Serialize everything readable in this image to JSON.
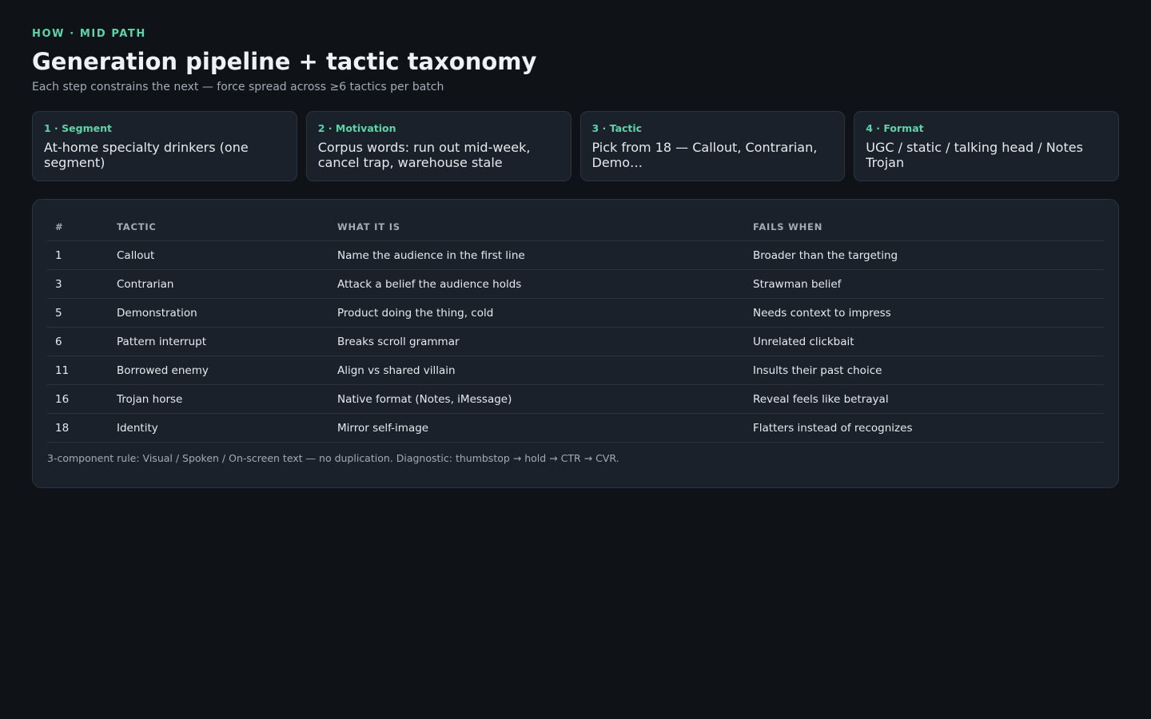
{
  "header": {
    "eyebrow": "HOW · MID PATH",
    "title": "Generation pipeline + tactic taxonomy",
    "subtitle": "Each step constrains the next — force spread across ≥6 tactics per batch"
  },
  "steps": [
    {
      "label": "1 · Segment",
      "text": "At-home specialty drinkers (one segment)"
    },
    {
      "label": "2 · Motivation",
      "text": "Corpus words: run out mid-week, cancel trap, warehouse stale"
    },
    {
      "label": "3 · Tactic",
      "text": "Pick from 18 — Callout, Contrarian, Demo…"
    },
    {
      "label": "4 · Format",
      "text": "UGC / static / talking head / Notes Trojan"
    }
  ],
  "table": {
    "headers": [
      "#",
      "TACTIC",
      "WHAT IT IS",
      "FAILS WHEN"
    ],
    "rows": [
      [
        "1",
        "Callout",
        "Name the audience in the first line",
        "Broader than the targeting"
      ],
      [
        "3",
        "Contrarian",
        "Attack a belief the audience holds",
        "Strawman belief"
      ],
      [
        "5",
        "Demonstration",
        "Product doing the thing, cold",
        "Needs context to impress"
      ],
      [
        "6",
        "Pattern interrupt",
        "Breaks scroll grammar",
        "Unrelated clickbait"
      ],
      [
        "11",
        "Borrowed enemy",
        "Align vs shared villain",
        "Insults their past choice"
      ],
      [
        "16",
        "Trojan horse",
        "Native format (Notes, iMessage)",
        "Reveal feels like betrayal"
      ],
      [
        "18",
        "Identity",
        "Mirror self-image",
        "Flatters instead of recognizes"
      ]
    ]
  },
  "footnote": "3-component rule: Visual / Spoken / On-screen text — no duplication. Diagnostic: thumbstop → hold → CTR → CVR.",
  "colors": {
    "background": "#0f1317",
    "card": "#1b212b",
    "accent": "#5fd3a8",
    "muted_text": "#a3abb6"
  }
}
